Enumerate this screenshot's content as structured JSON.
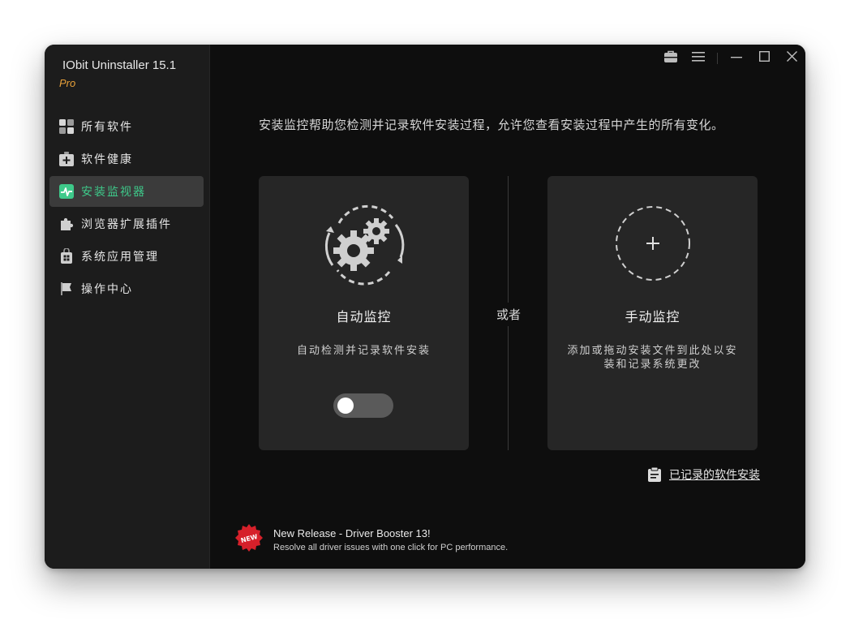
{
  "app": {
    "title": "IObit Uninstaller 15.1",
    "edition": "Pro"
  },
  "sidebar": {
    "items": [
      {
        "label": "所有软件",
        "icon": "grid-icon",
        "active": false
      },
      {
        "label": "软件健康",
        "icon": "medkit-icon",
        "active": false
      },
      {
        "label": "安装监视器",
        "icon": "monitor-pulse-icon",
        "active": true
      },
      {
        "label": "浏览器扩展插件",
        "icon": "puzzle-icon",
        "active": false
      },
      {
        "label": "系统应用管理",
        "icon": "windows-bag-icon",
        "active": false
      },
      {
        "label": "操作中心",
        "icon": "flag-icon",
        "active": false
      }
    ]
  },
  "titlebar": {
    "icons": [
      "toolbox-icon",
      "menu-icon",
      "minimize-icon",
      "maximize-icon",
      "close-icon"
    ]
  },
  "main": {
    "intro": "安装监控帮助您检测并记录软件安装过程，允许您查看安装过程中产生的所有变化。",
    "auto_card": {
      "title": "自动监控",
      "description": "自动检测并记录软件安装",
      "toggle_on": false
    },
    "separator": "或者",
    "manual_card": {
      "title": "手动监控",
      "description": "添加或拖动安装文件到此处以安装和记录系统更改"
    },
    "recorded_link": "已记录的软件安装",
    "promo": {
      "badge": "NEW",
      "title": "New Release - Driver Booster 13!",
      "subtitle": "Resolve all driver issues with one click for PC performance."
    }
  },
  "colors": {
    "accent": "#3ec98a",
    "edition": "#e8a13a",
    "badge": "#d6202a"
  }
}
